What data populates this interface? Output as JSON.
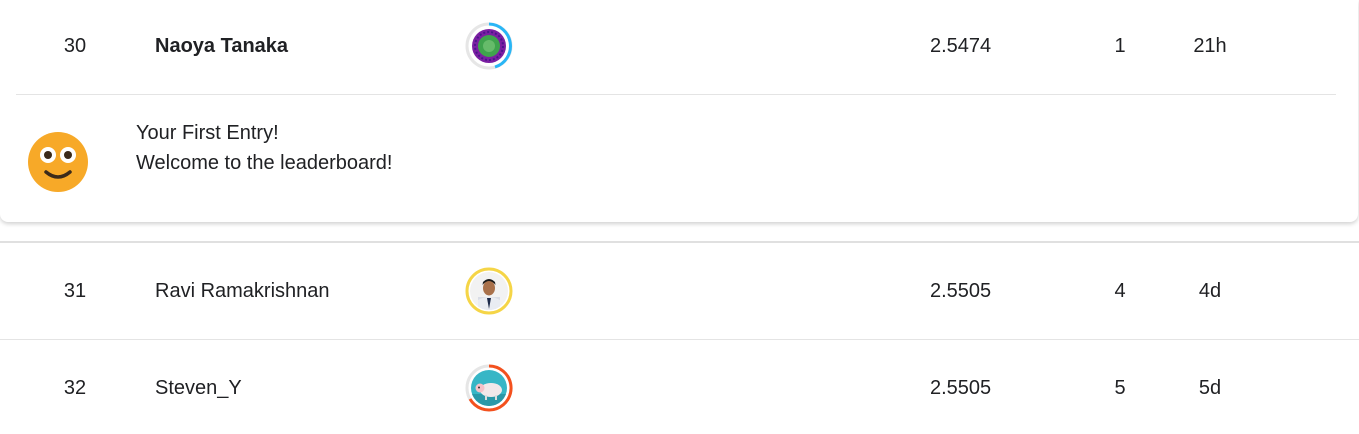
{
  "current_entry": {
    "rank": "30",
    "name": "Naoya Tanaka",
    "avatar": "purple-green-swirl-avatar",
    "score": "2.5474",
    "entries": "1",
    "last": "21h"
  },
  "first_entry_banner": {
    "title": "Your First Entry!",
    "message": "Welcome to the leaderboard!",
    "icon": "smiley-face-icon"
  },
  "rows": [
    {
      "rank": "31",
      "name": "Ravi Ramakrishnan",
      "avatar": "person-photo-avatar",
      "score": "2.5505",
      "entries": "4",
      "last": "4d"
    },
    {
      "rank": "32",
      "name": "Steven_Y",
      "avatar": "sheep-picture-avatar",
      "score": "2.5505",
      "entries": "5",
      "last": "5d"
    }
  ],
  "colors": {
    "tier_ring_blue": "#29b6f6",
    "tier_ring_gold": "#f5d547",
    "tier_ring_orange": "#f4511e",
    "emoji_face": "#f7a928"
  }
}
